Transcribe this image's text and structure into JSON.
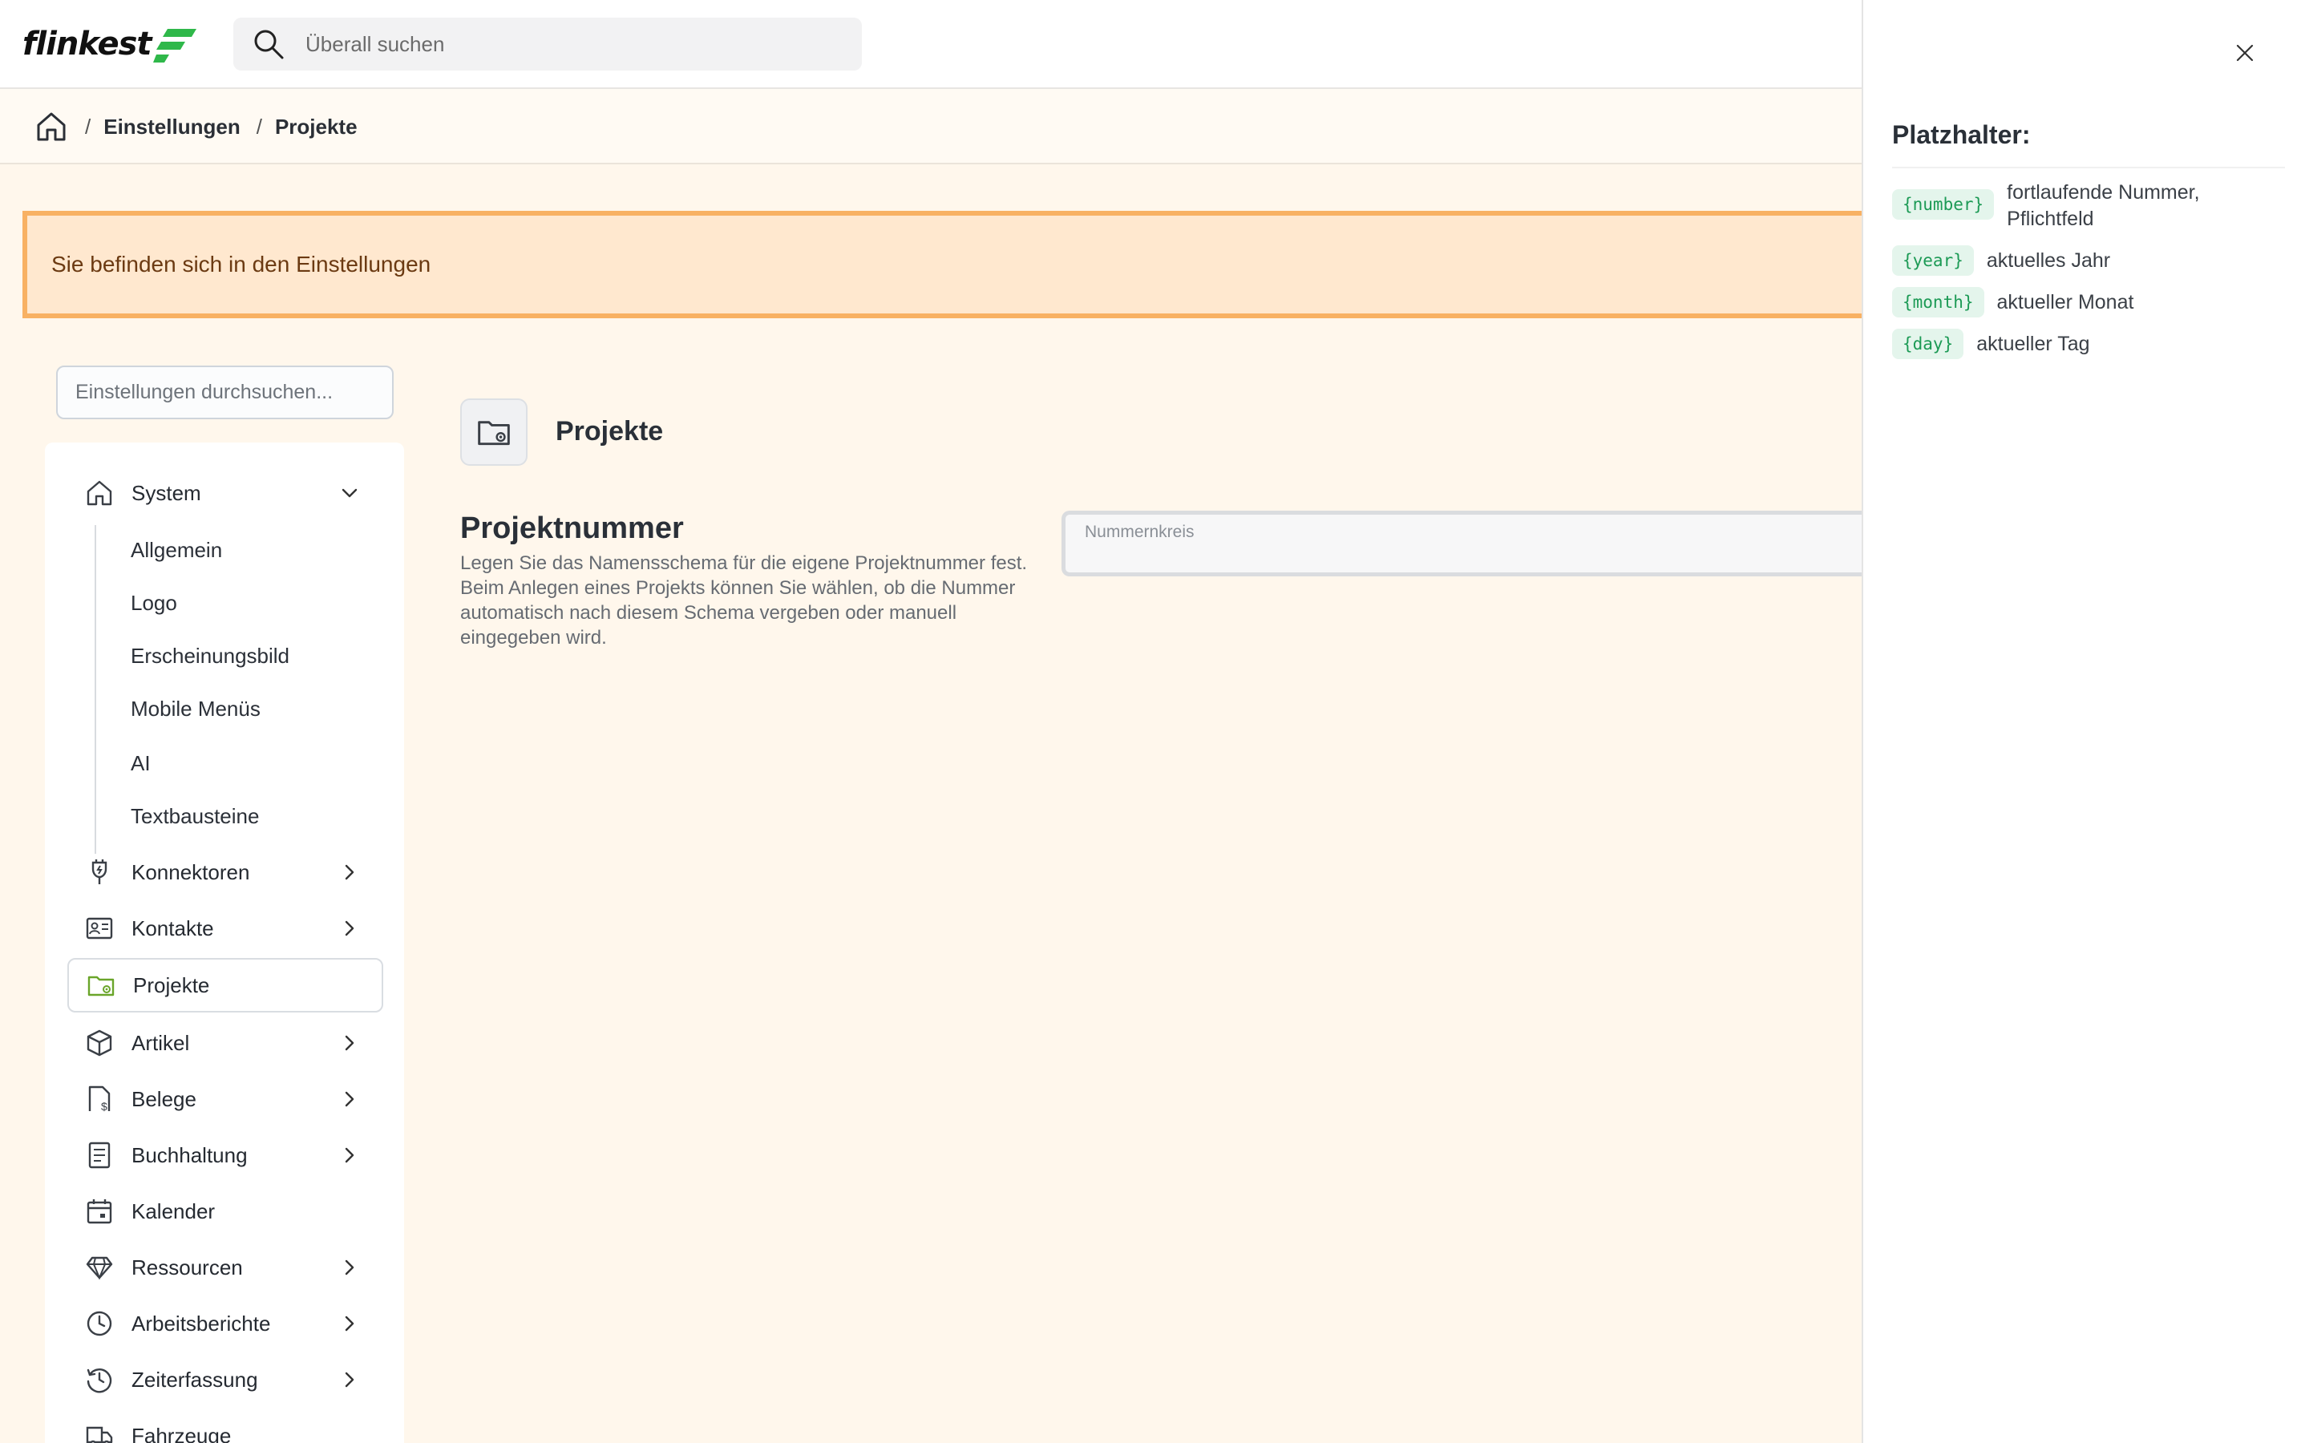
{
  "app": {
    "logo_text": "flinkest",
    "brand_color": "#2fb84a",
    "search_placeholder": "Überall suchen"
  },
  "breadcrumb": {
    "items": [
      "Einstellungen",
      "Projekte"
    ]
  },
  "banner": {
    "text": "Sie befinden sich in den Einstellungen"
  },
  "sidebar": {
    "search_placeholder": "Einstellungen durchsuchen...",
    "system_label": "System",
    "system_subitems": [
      "Allgemein",
      "Logo",
      "Erscheinungsbild",
      "Mobile Menüs",
      "AI",
      "Textbausteine"
    ],
    "items": [
      {
        "label": "Konnektoren",
        "icon": "plug-icon",
        "chevron": true
      },
      {
        "label": "Kontakte",
        "icon": "contact-card-icon",
        "chevron": true
      },
      {
        "label": "Projekte",
        "icon": "folder-gear-icon",
        "chevron": false,
        "active": true
      },
      {
        "label": "Artikel",
        "icon": "box-icon",
        "chevron": true
      },
      {
        "label": "Belege",
        "icon": "receipt-icon",
        "chevron": true
      },
      {
        "label": "Buchhaltung",
        "icon": "ledger-icon",
        "chevron": true
      },
      {
        "label": "Kalender",
        "icon": "calendar-icon",
        "chevron": false
      },
      {
        "label": "Ressourcen",
        "icon": "diamond-icon",
        "chevron": true
      },
      {
        "label": "Arbeitsberichte",
        "icon": "clock-icon",
        "chevron": true
      },
      {
        "label": "Zeiterfassung",
        "icon": "history-icon",
        "chevron": true
      },
      {
        "label": "Fahrzeuge",
        "icon": "truck-icon",
        "chevron": false
      }
    ]
  },
  "content": {
    "page_title": "Projekte",
    "section_title": "Projektnummer",
    "section_description": "Legen Sie das Namensschema für die eigene Projektnummer fest. Beim Anlegen eines Projekts können Sie wählen, ob die Nummer automatisch nach diesem Schema vergeben oder manuell eingegeben wird.",
    "field_label": "Nummernkreis",
    "field_value": ""
  },
  "drawer": {
    "title": "Platzhalter:",
    "placeholders": [
      {
        "tag": "{number}",
        "description": "fortlaufende Nummer, Pflichtfeld"
      },
      {
        "tag": "{year}",
        "description": "aktuelles Jahr"
      },
      {
        "tag": "{month}",
        "description": "aktueller Monat"
      },
      {
        "tag": "{day}",
        "description": "aktueller Tag"
      }
    ]
  }
}
